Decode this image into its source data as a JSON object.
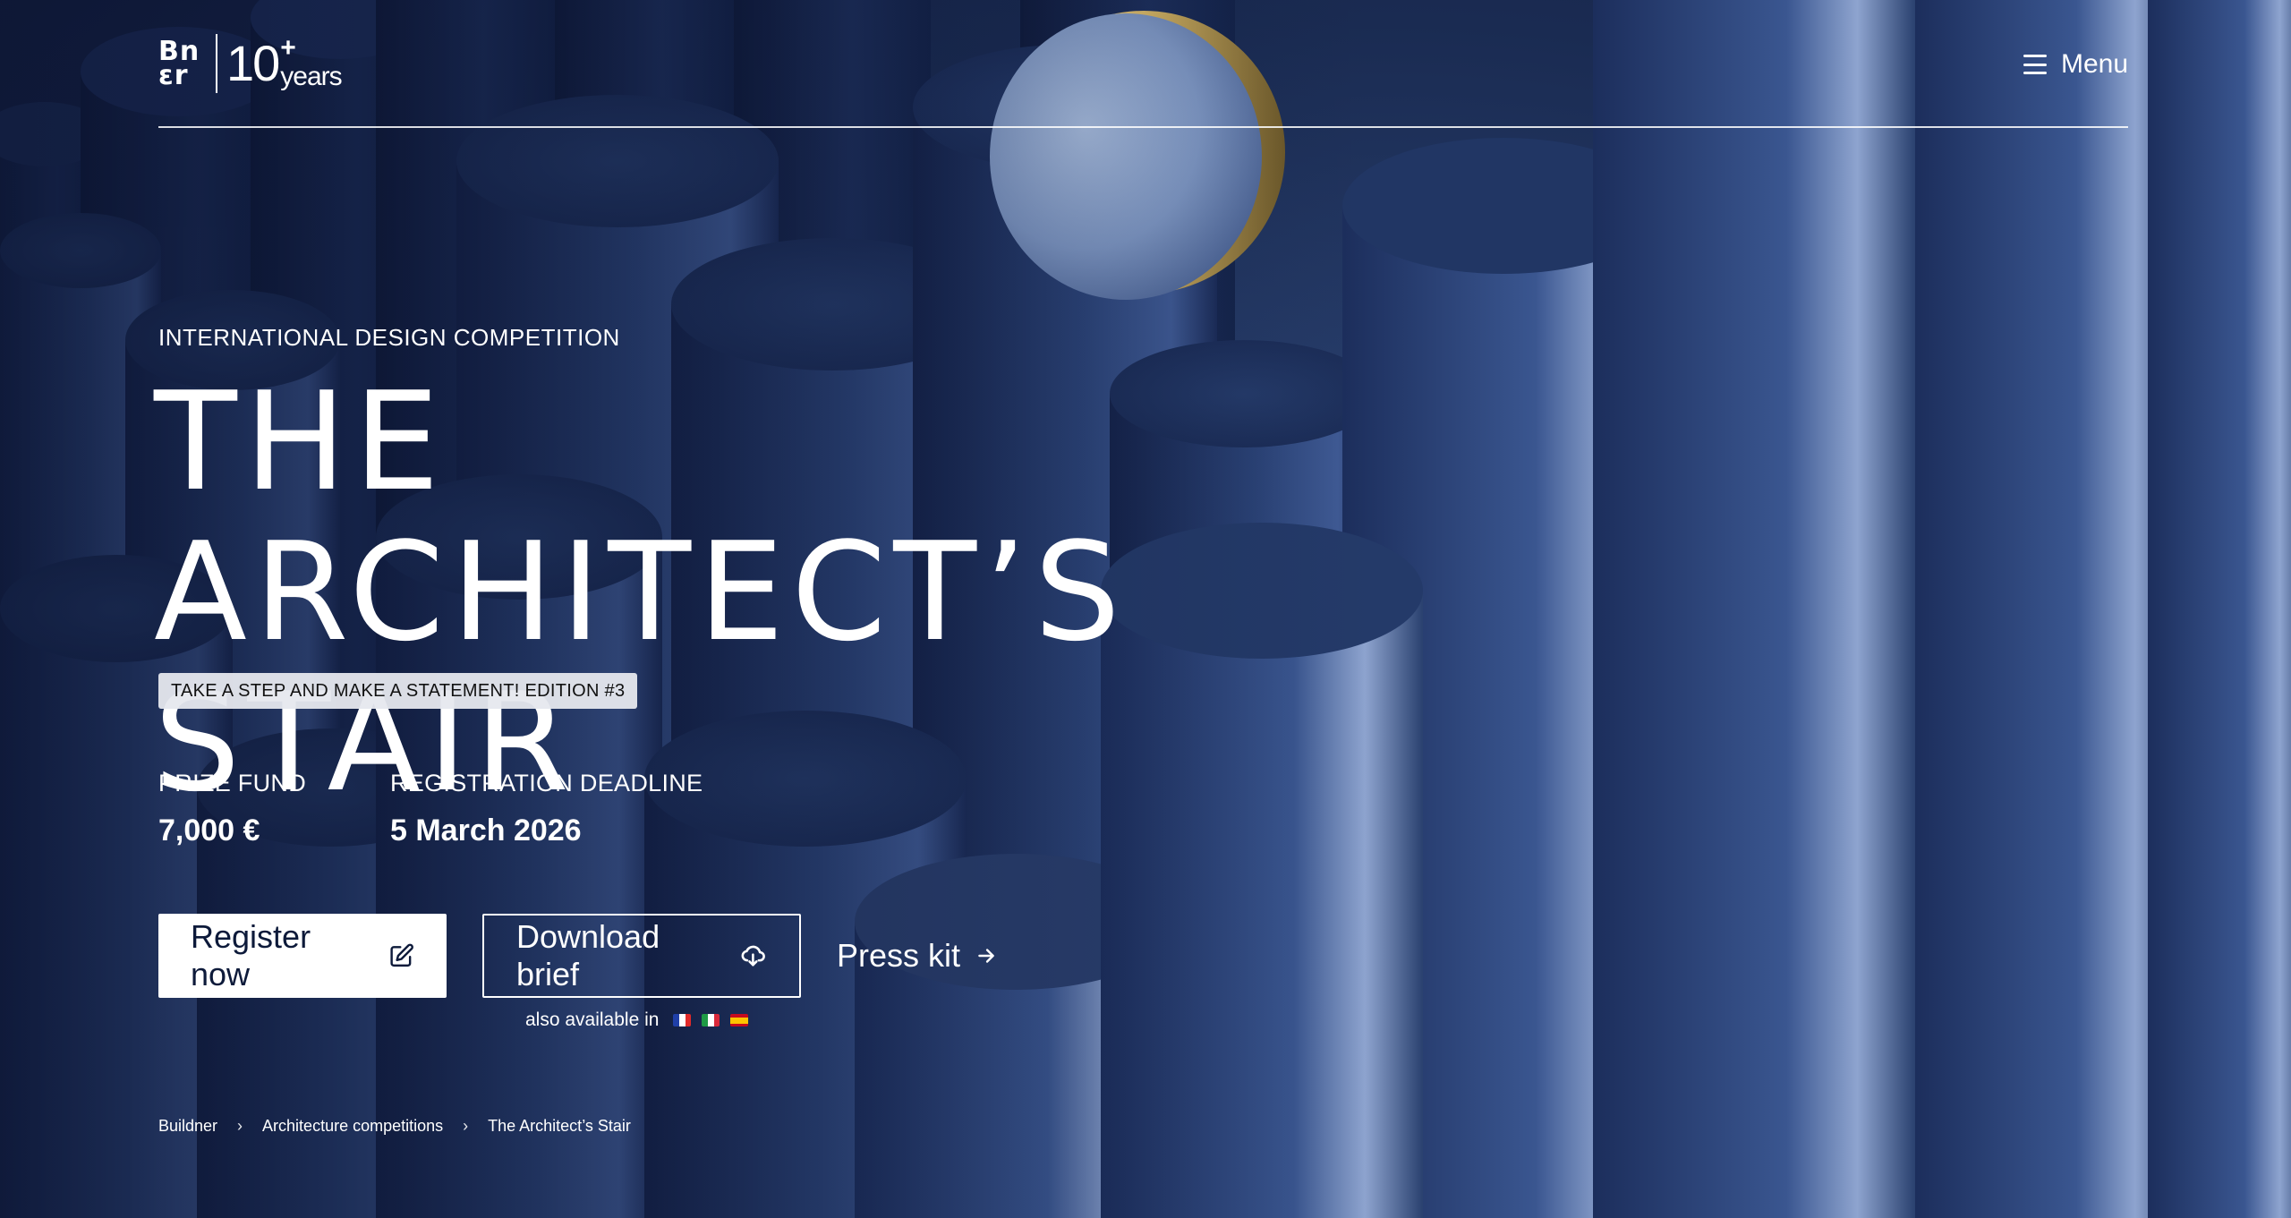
{
  "header": {
    "logo_mark_top": "Bn",
    "logo_mark_bottom": "ɛr",
    "logo_years_number": "10",
    "logo_years_plus": "+",
    "logo_years_word": "years",
    "menu_label": "Menu"
  },
  "hero": {
    "eyebrow": "INTERNATIONAL DESIGN COMPETITION",
    "title_line1": "THE ARCHITECT’S",
    "title_line2": "STAIR",
    "tagline": "TAKE A STEP AND MAKE A STATEMENT! EDITION #3",
    "facts": [
      {
        "label": "PRIZE FUND",
        "value": "7,000 €"
      },
      {
        "label": "REGISTRATION DEADLINE",
        "value": "5 March 2026"
      }
    ]
  },
  "cta": {
    "register_label": "Register now",
    "download_label": "Download brief",
    "press_label": "Press kit",
    "also_available": "also available in",
    "languages": [
      "fr",
      "it",
      "es"
    ]
  },
  "breadcrumb": [
    {
      "label": "Buildner"
    },
    {
      "label": "Architecture competitions"
    },
    {
      "label": "The Architect’s Stair"
    }
  ],
  "colors": {
    "background": "#1a2c52",
    "accent_white": "#ffffff",
    "button_text": "#0d1a3a",
    "tagline_bg": "#e6e8ee"
  },
  "icons": {
    "menu": "hamburger-icon",
    "register": "edit-icon",
    "download": "cloud-download-icon",
    "press": "arrow-right-icon",
    "breadcrumb_sep": "chevron-right-icon"
  }
}
